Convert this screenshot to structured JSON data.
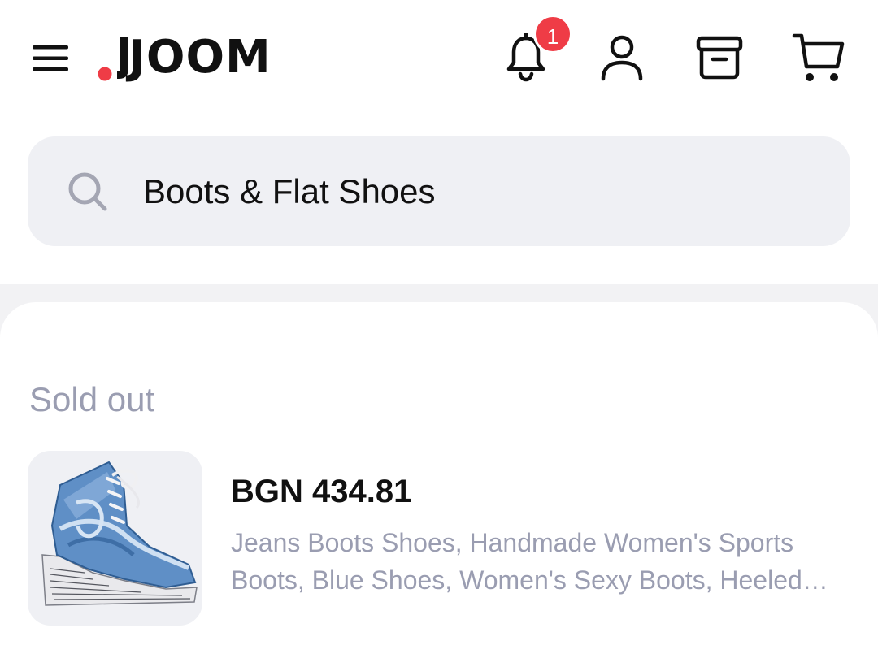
{
  "header": {
    "brand": "JOOM",
    "notification_count": "1"
  },
  "search": {
    "value": "Boots & Flat Shoes"
  },
  "section": {
    "title": "Sold out"
  },
  "products": [
    {
      "price": "BGN 434.81",
      "title": "Jeans Boots Shoes, Handmade Women's Sports Boots, Blue Shoes, Women's Sexy Boots, Heeled…"
    }
  ],
  "icons": {
    "menu": "hamburger-menu-icon",
    "notifications": "bell-icon",
    "profile": "user-icon",
    "orders": "archive-box-icon",
    "cart": "shopping-cart-icon",
    "search": "search-icon"
  },
  "colors": {
    "brand_red": "#ef3c46",
    "muted_text": "#9a9db1",
    "search_bg": "#eff0f4"
  }
}
